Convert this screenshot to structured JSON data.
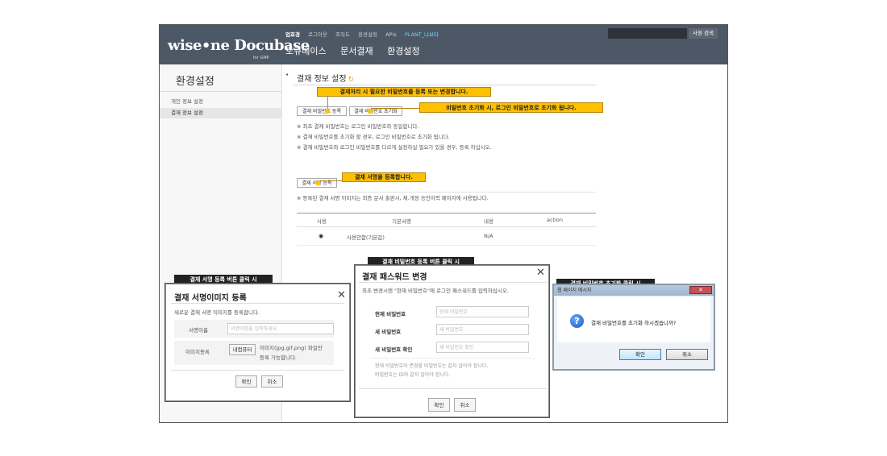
{
  "header": {
    "logo": "wise•ne Docubase",
    "logo_sub": "for GMP",
    "top_nav": [
      "업효경",
      "로그아웃",
      "조직도",
      "환경설정",
      "APIs",
      "PLANT_나보타"
    ],
    "main_nav": [
      "도큐베이스",
      "문서결재",
      "환경설정"
    ],
    "search_button": "사원 검색"
  },
  "sidebar": {
    "title": "환경설정",
    "items": [
      "개인 정보 설정",
      "결재 정보 설정"
    ]
  },
  "content": {
    "title": "결재 정보 설정",
    "buttons": {
      "register_password": "결재 비밀번호 등록",
      "reset_password": "결재 비밀번호 초기화",
      "register_signature": "결재 서명 등록"
    },
    "notes_password": [
      "※ 최초 결재 비밀번호는 로그인 비밀번호와 동일합니다.",
      "※ 결재 비밀번호를 초기화 할 경우, 로그인 비밀번호로 초기화 됩니다.",
      "※ 결재 비밀번호와 로그인 비밀번호를 다르게 설정하실 필요가 있을 경우, 등록 하십시오."
    ],
    "note_signature": "※ 등록된 결재 서명 이미지는 최종 문서 출판시, 제.개정 승인이력 페이지에 사용됩니다.",
    "table": {
      "headers": [
        "사용",
        "기본서명",
        "내용",
        "action"
      ],
      "rows": [
        {
          "use": "◉",
          "name": "사용안함(기본값)",
          "content": "N/A",
          "action": ""
        }
      ]
    }
  },
  "callouts": {
    "register_password": "결재처리 시 필요한 비밀번호를 등록 또는 변경합니다.",
    "reset_password": "비밀번호 초기화 시, 로그인 비밀번호로 초기화 됩니다.",
    "register_signature": "결재 서명을 등록합니다.",
    "dialog_signature": "결재 서명 등록 버튼 클릭 시",
    "dialog_password": "결재 비밀번호 등록 버튼 클릭 시",
    "dialog_reset": "결재 비밀번호 초기화 클릭 시"
  },
  "signature_dialog": {
    "title": "결재 서명이미지 등록",
    "description": "새로운 결재 서명 이미지를 등록합니다.",
    "name_label": "서명이름",
    "name_placeholder": "서명이름을 입력하세요.",
    "image_label": "이미지등록",
    "image_button": "내컴퓨터",
    "image_hint_1": "이미지(jpg,gif,png) 파일만",
    "image_hint_2": "등록 가능합니다.",
    "ok": "확인",
    "cancel": "취소"
  },
  "password_dialog": {
    "title": "결재 패스워드 변경",
    "description": "최초 변경시엔 \"현재 비밀번호\"에 로그인 패스워드를 입력하십시오.",
    "current_label": "현재 비밀번호",
    "current_placeholder": "현재 비밀번호",
    "new_label": "새 비밀번호",
    "new_placeholder": "새 비밀번호",
    "confirm_label": "새 비밀번호 확인",
    "confirm_placeholder": "새 비밀번호 확인",
    "hint_1": "현재 비밀번호와 변경할 비밀번호는 같지 않아야 합니다.",
    "hint_2": "비밀번호는 ID와 같지 않아야 합니다.",
    "ok": "확인",
    "cancel": "취소"
  },
  "reset_dialog": {
    "titlebar": "웹 페이지 메시지",
    "message": "결재 비밀번호를 초기화 하시겠습니까?",
    "ok": "확인",
    "cancel": "취소"
  }
}
